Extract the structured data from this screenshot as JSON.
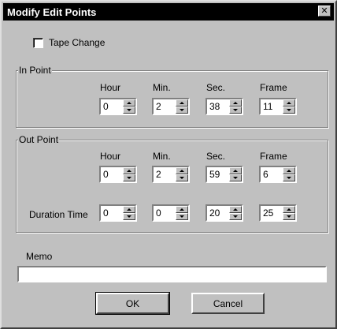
{
  "window": {
    "title": "Modify Edit Points",
    "close_glyph": "✕",
    "close_icon": "close-icon"
  },
  "tape_change": {
    "label": "Tape Change",
    "checked": false
  },
  "in_point": {
    "label": "In Point",
    "headers": [
      "Hour",
      "Min.",
      "Sec.",
      "Frame"
    ],
    "values": [
      "0",
      "2",
      "38",
      "11"
    ]
  },
  "out_point": {
    "label": "Out Point",
    "headers": [
      "Hour",
      "Min.",
      "Sec.",
      "Frame"
    ],
    "values": [
      "0",
      "2",
      "59",
      "6"
    ],
    "duration_label": "Duration Time",
    "duration_values": [
      "0",
      "0",
      "20",
      "25"
    ]
  },
  "memo": {
    "label": "Memo",
    "value": ""
  },
  "buttons": {
    "ok": "OK",
    "cancel": "Cancel"
  }
}
